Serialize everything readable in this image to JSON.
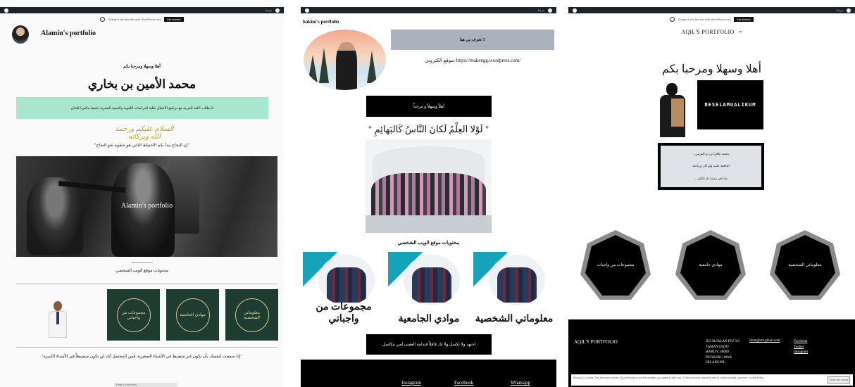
{
  "panels": [
    {
      "admin_bar": {
        "right": "مرحبا"
      },
      "wp_bar": {
        "text": "Design a site like this with WordPress.com",
        "button": "Get started"
      },
      "site_title": "Alamin's portfolio",
      "greeting": "أهلا وسهلا ومرحبا بكم",
      "name": "محمد الأمين بن بخاري",
      "intro": "انا طالب اللغة العربية مع برنامج الأعمال بكلية الدراسات اللغوية والتنمية البشرية جامعة ماليزيا كلنتان",
      "bismillah": "السلام عليكم ورحمة الله وبركاته",
      "quote_1": "\"إن النجاح يبدأ بكم الاحتياط الثاني هو خطوة نحو النجاح\"",
      "hero_caption": "Alamin's portfolio",
      "contents_label": "محتويات موقع الويب الشخصي",
      "tiles": [
        "مجموعات من واجباتي",
        "موادي الجامعية",
        "معلوماتي الشخصية"
      ],
      "quote_2": "\"إذا سمحت لنفسك بأن تكون غير منضبط في الأشياء الصغيرة، فمن المحتمل أنك لن تكون منضبطاً في الأشياء الكبيرة\"",
      "footer_input": "Write a comment"
    },
    {
      "admin_bar": {
        "right": "مرحبا"
      },
      "site_title": "hakim's portfolio",
      "about_button": "تعرف بي هنا !!",
      "website_label": "موقع الكتروني:",
      "website_link": "https://makengg.wordpress.com/",
      "welcome": "أهلاً وسهلاً و مرحباً",
      "quote": "\" لَوْلا العِلْمُ لَكانَ النَّاسُ كَالبَهائِمِ \"",
      "contents_label": "محتويات موقع الويب الشخصي",
      "cards": [
        "مجموعات من واجباتي",
        "موادي الجامعية",
        "معلوماتي الشخصية"
      ],
      "motto": "اجتهد ولا تكسل ولا تك غافلاً فندامة العقبى لمن يتكاسل",
      "footer_links": [
        "Instagram",
        "Facebook",
        "Whatsapp"
      ]
    },
    {
      "admin_bar": {
        "right": "مرحبا"
      },
      "wp_bar": {
        "text": "Design a site like this with WordPress.com",
        "button": "Get started"
      },
      "site_title": "AQIL'S PORTFOLIO",
      "menu_icon": "=",
      "greeting": "أهلا وسهلا ومرحبا بكم",
      "logo_text": "BESELAMUALIKUM",
      "info_lines": [
        "... محمد عاقل ابن ذو الفرنين:",
        "الدافعة علمه ولو كان ورياضة",
        "... ماذا في مدينة دار الكثير"
      ],
      "shapes": [
        "مجموعات من واجبات",
        "موادي جامعية",
        "معلوماتي الشخصية"
      ],
      "footer": {
        "title": "AQIL'S PORTFOLIO",
        "address": [
          "NO 34 JALAN PJU 3/3",
          "TAMAN DATO'",
          "HARUN, 46000",
          "PETALING JAYA",
          "SELANGOR"
        ],
        "email": "ilium@stu.gmail.com",
        "social": [
          "Facebook",
          "Twitter",
          "Instagram"
        ]
      },
      "cookie_text": "Privacy & Cookies: This site uses cookies. By continuing to use this website, you agree to their use. To find out more, including how to control cookies, see here: Cookie Policy",
      "cookie_button": "Close and accept"
    }
  ]
}
